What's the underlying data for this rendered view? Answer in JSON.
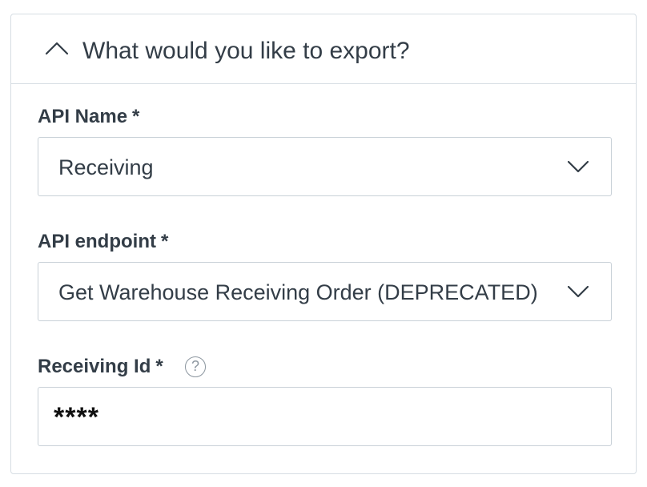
{
  "section": {
    "title": "What would you like to export?",
    "expanded": true,
    "toggle_icon": "chevron-up-icon"
  },
  "fields": {
    "api_name": {
      "label": "API Name",
      "required_marker": "*",
      "value": "Receiving",
      "icon": "chevron-down-icon"
    },
    "api_endpoint": {
      "label": "API endpoint",
      "required_marker": "*",
      "value": "Get Warehouse Receiving Order (DEPRECATED)",
      "icon": "chevron-down-icon"
    },
    "receiving_id": {
      "label": "Receiving Id",
      "required_marker": "*",
      "help_icon": "question-circle-icon",
      "help_glyph": "?",
      "value": "****"
    }
  },
  "colors": {
    "text": "#333d47",
    "border": "#c9d1d8",
    "divider": "#d6dde3",
    "help_icon": "#8c969f"
  }
}
